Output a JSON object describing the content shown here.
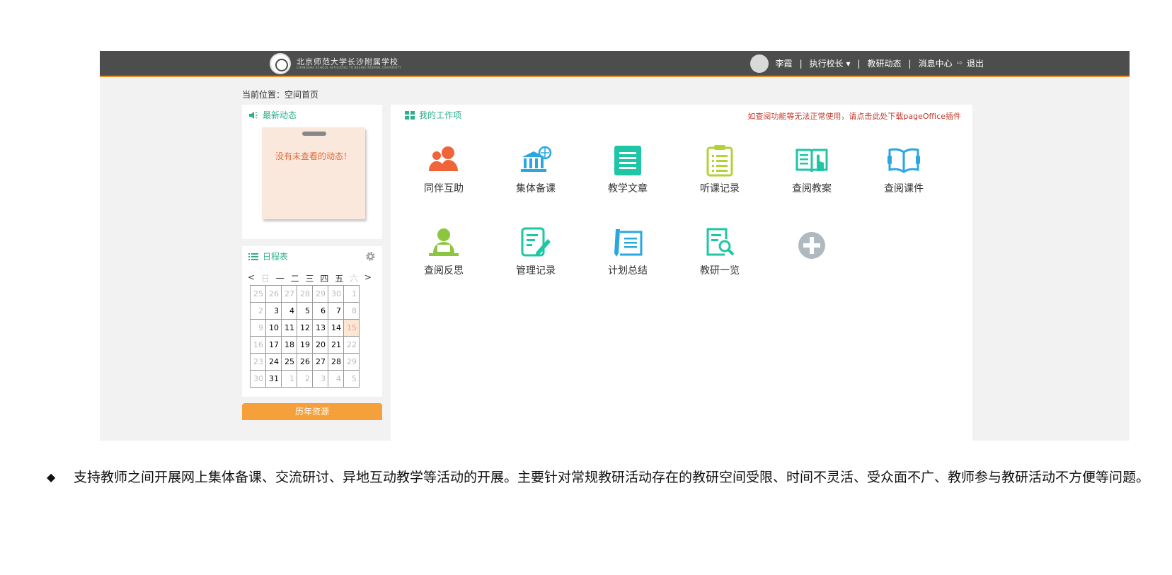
{
  "header": {
    "school_name_cn": "北京师范大学长沙附属学校",
    "school_name_en": "CHANGSHA SCHOOL AFFILIATED TO BEIJING NORMAL UNIVERSITY",
    "user_name": "李霞",
    "role": "执行校长",
    "teaching_news": "教研动态",
    "message_center": "消息中心",
    "logout": "退出"
  },
  "breadcrumb": "当前位置：空间首页",
  "news": {
    "title": "最新动态",
    "message": "没有未查看的动态！"
  },
  "schedule": {
    "title": "日程表",
    "prev": "<",
    "next": ">",
    "weekdays": [
      "日",
      "一",
      "二",
      "三",
      "四",
      "五",
      "六"
    ],
    "weeks": [
      [
        "25",
        "26",
        "27",
        "28",
        "29",
        "30",
        "1"
      ],
      [
        "2",
        "3",
        "4",
        "5",
        "6",
        "7",
        "8"
      ],
      [
        "9",
        "10",
        "11",
        "12",
        "13",
        "14",
        "15"
      ],
      [
        "16",
        "17",
        "18",
        "19",
        "20",
        "21",
        "22"
      ],
      [
        "23",
        "24",
        "25",
        "26",
        "27",
        "28",
        "29"
      ],
      [
        "30",
        "31",
        "1",
        "2",
        "3",
        "4",
        "5"
      ]
    ]
  },
  "history_button": "历年资源",
  "work": {
    "title": "我的工作项",
    "notice": "如查阅功能等无法正常使用，请点击此处下载pageOffice插件",
    "items": [
      {
        "label": "同伴互助",
        "icon": "people-icon",
        "color": "#f0643a"
      },
      {
        "label": "集体备课",
        "icon": "building-globe-icon",
        "color": "#2aa7df"
      },
      {
        "label": "教学文章",
        "icon": "document-icon",
        "color": "#1fc6a6"
      },
      {
        "label": "听课记录",
        "icon": "clipboard-icon",
        "color": "#b3d235"
      },
      {
        "label": "查阅教案",
        "icon": "open-book-icon",
        "color": "#1fc6a6"
      },
      {
        "label": "查阅课件",
        "icon": "book-icon",
        "color": "#2aa7df"
      },
      {
        "label": "查阅反思",
        "icon": "person-desk-icon",
        "color": "#8cc63f"
      },
      {
        "label": "管理记录",
        "icon": "edit-note-icon",
        "color": "#1fc6a6"
      },
      {
        "label": "计划总结",
        "icon": "pen-paper-icon",
        "color": "#2aa7df"
      },
      {
        "label": "教研一览",
        "icon": "search-doc-icon",
        "color": "#1fc6a6"
      },
      {
        "label": "",
        "icon": "add-icon",
        "color": "#b0b8c0"
      }
    ]
  },
  "caption": {
    "bullet": "◆",
    "text": "支持教师之间开展网上集体备课、交流研讨、异地互动教学等活动的开展。主要针对常规教研活动存在的教研空间受限、时间不灵活、受众面不广、教师参与教研活动不方便等问题。"
  }
}
